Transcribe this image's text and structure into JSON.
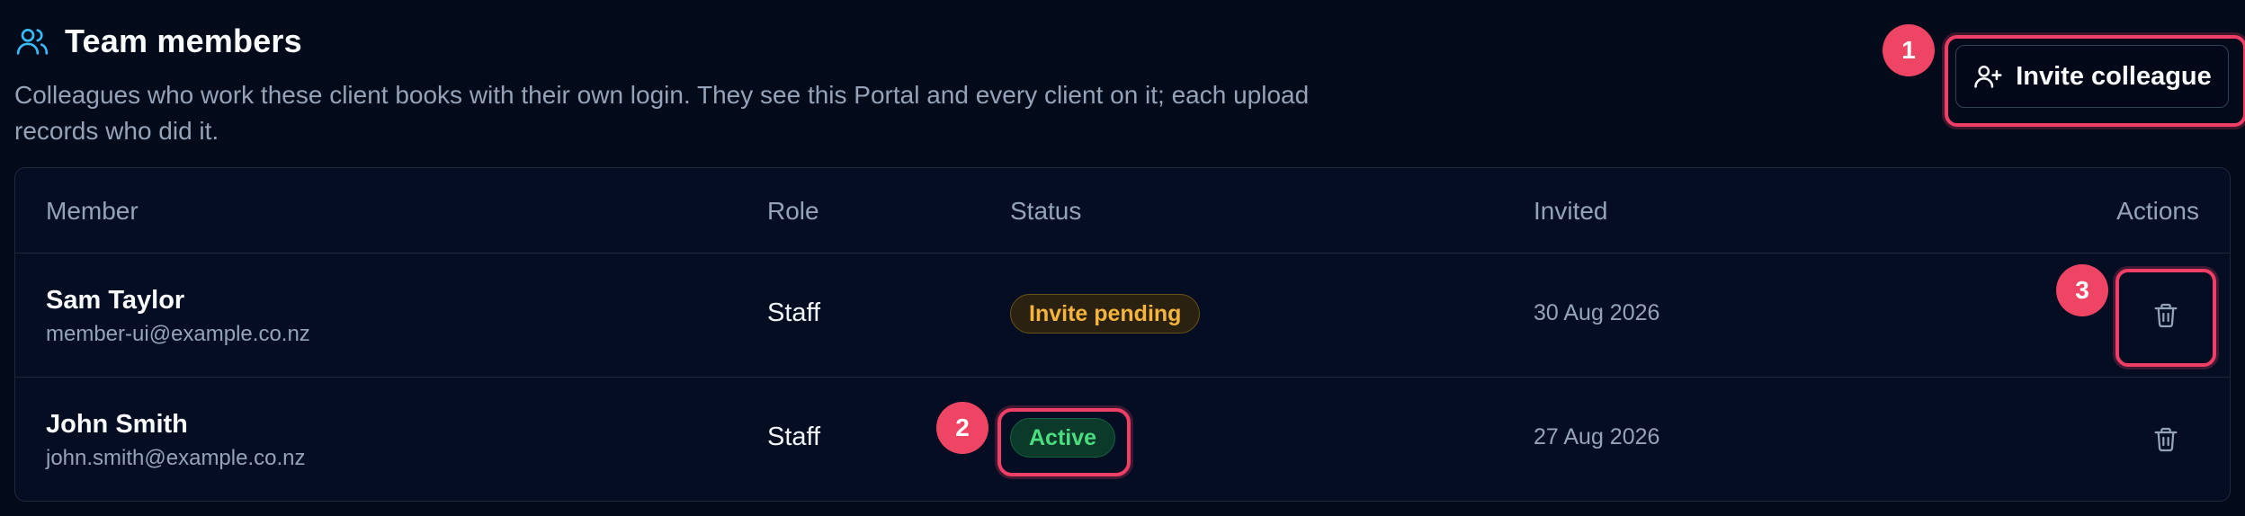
{
  "header": {
    "title": "Team members",
    "subtitle": "Colleagues who work these client books with their own login. They see this Portal and every client on it; each upload records who did it.",
    "icon": "users-icon"
  },
  "actions": {
    "invite_label": "Invite colleague",
    "invite_icon": "user-plus-icon"
  },
  "table": {
    "columns": [
      "Member",
      "Role",
      "Status",
      "Invited",
      "Actions"
    ],
    "rows": [
      {
        "name": "Sam Taylor",
        "email": "member-ui@example.co.nz",
        "role": "Staff",
        "status": "Invite pending",
        "invited": "30 Aug 2026",
        "action_icon": "trash-icon"
      },
      {
        "name": "John Smith",
        "email": "john.smith@example.co.nz",
        "role": "Staff",
        "status": "Active",
        "invited": "27 Aug 2026",
        "action_icon": "trash-icon"
      }
    ]
  },
  "annotations": [
    "1",
    "2",
    "3"
  ],
  "colors": {
    "background": "#030a1a",
    "accent_icon": "#38bdf8",
    "annotation": "#ef4565",
    "pending": "#f5b43b",
    "active": "#4ade80"
  }
}
